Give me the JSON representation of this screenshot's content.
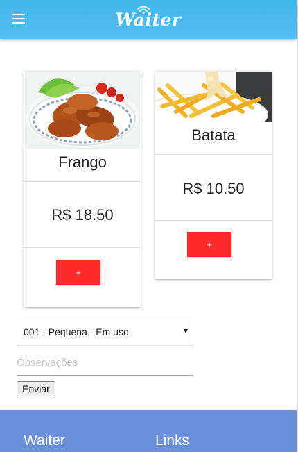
{
  "header": {
    "brand": "Waiter",
    "menu_icon": "hamburger-menu-icon",
    "brand_icon": "wifi-icon",
    "color": "#3fb6ec"
  },
  "products": [
    {
      "name": "Frango",
      "price": "R$ 18.50",
      "add_label": "+",
      "image": "roasted-chicken-photo"
    },
    {
      "name": "Batata",
      "price": "R$ 10.50",
      "add_label": "+",
      "image": "french-fries-photo"
    }
  ],
  "order_form": {
    "table_select": {
      "selected": "001 - Pequena - Em uso",
      "icon": "caret-down-icon"
    },
    "notes": {
      "value": "",
      "placeholder": "Observações"
    },
    "submit_label": "Enviar"
  },
  "footer": {
    "brand": "Waiter",
    "links_heading": "Links",
    "color": "#6b8fd8"
  },
  "colors": {
    "add_button": "#ff2b2b",
    "header": "#3fb6ec",
    "footer": "#6b8fd8"
  }
}
